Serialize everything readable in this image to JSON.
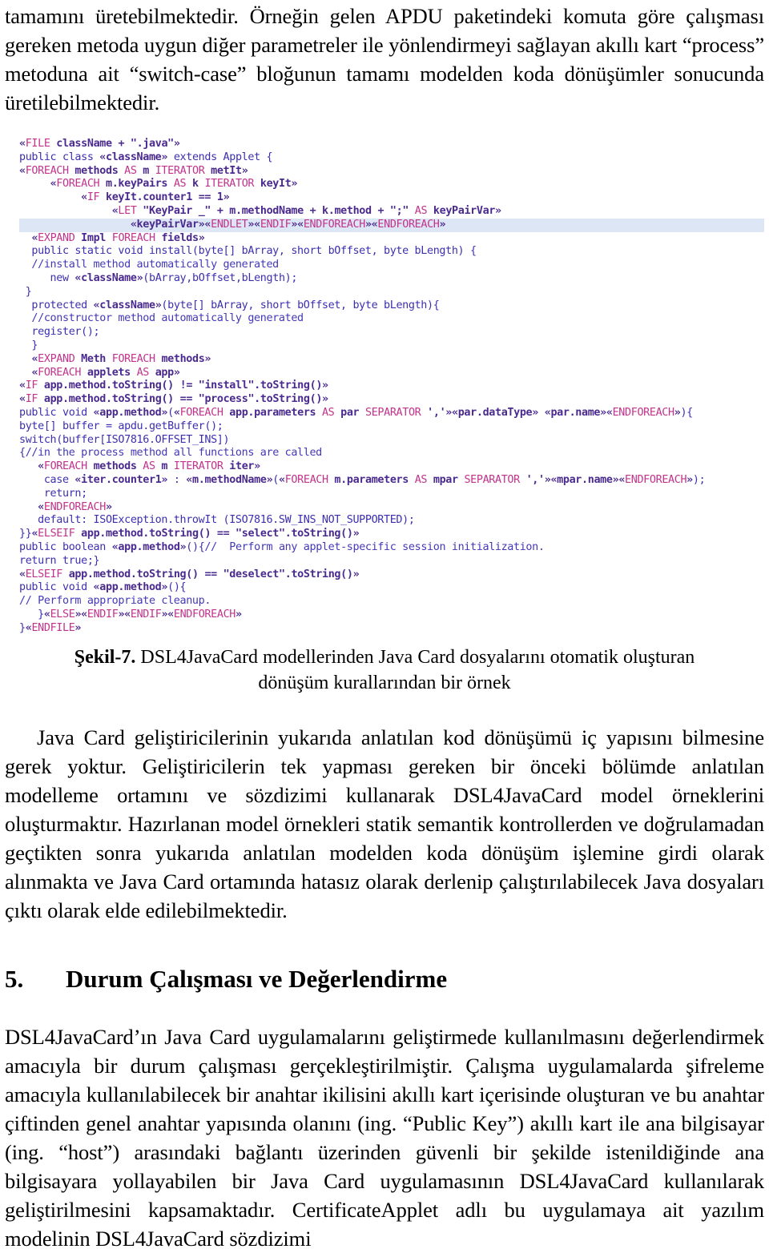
{
  "document": {
    "language": "tr",
    "paragraphs": {
      "intro": "tamamını üretebilmektedir. Örneğin gelen APDU paketindeki komuta göre çalışması gereken metoda uygun diğer parametreler ile yönlendirmeyi sağlayan akıllı kart “process” metoduna ait “switch-case” bloğunun tamamı modelden koda dönüşümler sonucunda üretilebilmektedir.",
      "after_figure": "Java Card geliştiricilerinin yukarıda anlatılan kod dönüşümü iç yapısını bilmesine gerek yoktur. Geliştiricilerin tek yapması gereken bir önceki bölümde anlatılan modelleme ortamını ve sözdizimi kullanarak DSL4JavaCard model örneklerini oluşturmaktır. Hazırlanan model örnekleri statik semantik kontrollerden ve doğrulamadan geçtikten sonra yukarıda anlatılan modelden koda dönüşüm işlemine girdi olarak alınmakta ve Java Card ortamında hatasız olarak derlenip çalıştırılabilecek Java dosyaları çıktı olarak elde edilebilmektedir.",
      "case_study": "DSL4JavaCard’ın Java Card uygulamalarını geliştirmede kullanılmasını değerlendirmek amacıyla bir durum çalışması gerçekleştirilmiştir. Çalışma uygulamalarda şifreleme amacıyla kullanılabilecek bir anahtar ikilisini akıllı kart içerisinde oluşturan ve bu anahtar çiftinden genel anahtar yapısında olanını (ing. “Public Key”) akıllı kart ile ana bilgisayar (ing. “host”) arasındaki bağlantı üzerinden güvenli bir şekilde istenildiğinde ana bilgisayara yollayabilen bir Java Card uygulamasının DSL4JavaCard kullanılarak geliştirilmesini kapsamaktadır. CertificateApplet adlı bu uygulamaya ait yazılım modelinin DSL4JavaCard sözdizimi"
    },
    "figure": {
      "label": "Şekil-7.",
      "caption_text": " DSL4JavaCard modellerinden Java Card dosyalarını otomatik oluşturan dönüşüm kurallarından bir örnek",
      "highlighted_line_index": 6,
      "code_lines": [
        "«FILE className + \".java\"»",
        "public class «className» extends Applet {",
        "«FOREACH methods AS m ITERATOR metIt»",
        "     «FOREACH m.keyPairs AS k ITERATOR keyIt»",
        "          «IF keyIt.counter1 == 1»",
        "               «LET \"KeyPair _\" + m.methodName + k.method + \";\" AS keyPairVar»",
        "                  «keyPairVar»«ENDLET»«ENDIF»«ENDFOREACH»«ENDFOREACH»",
        "  «EXPAND Impl FOREACH fields»",
        "  public static void install(byte[] bArray, short bOffset, byte bLength) {",
        "  //install method automatically generated",
        "     new «className»(bArray,bOffset,bLength);",
        " }",
        "  protected «className»(byte[] bArray, short bOffset, byte bLength){",
        "  //constructor method automatically generated",
        "  register();",
        "  }",
        "  «EXPAND Meth FOREACH methods»",
        "  «FOREACH applets AS app»",
        "«IF app.method.toString() != \"install\".toString()»",
        "«IF app.method.toString() == \"process\".toString()»",
        "public void «app.method»(«FOREACH app.parameters AS par SEPARATOR ','»«par.dataType» «par.name»«ENDFOREACH»){",
        "byte[] buffer = apdu.getBuffer();",
        "switch(buffer[ISO7816.OFFSET_INS])",
        "{//in the process method all functions are called",
        "   «FOREACH methods AS m ITERATOR iter»",
        "    case «iter.counter1» : «m.methodName»(«FOREACH m.parameters AS mpar SEPARATOR ','»«mpar.name»«ENDFOREACH»);",
        "    return;",
        "   «ENDFOREACH»",
        "   default: ISOException.throwIt (ISO7816.SW_INS_NOT_SUPPORTED);",
        "}}«ELSEIF app.method.toString() == \"select\".toString()»",
        "public boolean «app.method»(){//  Perform any applet-specific session initialization.",
        "return true;}",
        "«ELSEIF app.method.toString() == \"deselect\".toString()»",
        "public void «app.method»(){",
        "// Perform appropriate cleanup.",
        "   }«ELSE»«ENDIF»«ENDIF»«ENDFOREACH»",
        "}«ENDFILE»"
      ]
    },
    "section": {
      "number": "5.",
      "title": "Durum Çalışması ve Değerlendirme"
    }
  },
  "colors": {
    "page_background": "#ffffff",
    "text": "#000000",
    "code_default": "#3b2fb0",
    "code_directive": "#c2338c",
    "code_template": "#4a2a8f",
    "code_string": "#5b4bd6",
    "code_comment": "#4238b8",
    "highlight_line": "#dde6f4"
  }
}
